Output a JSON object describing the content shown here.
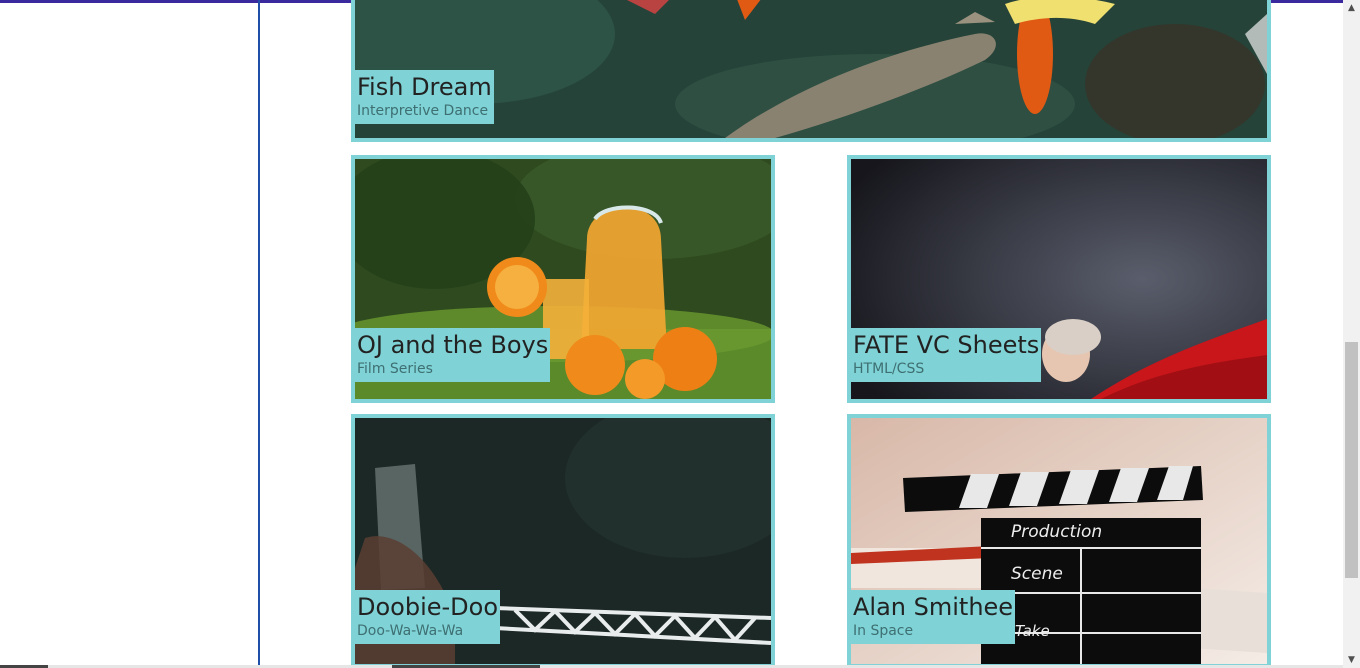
{
  "cards": [
    {
      "title": "Fish Dream",
      "subtitle": "Interpretive Dance"
    },
    {
      "title": "OJ and the Boys",
      "subtitle": "Film Series"
    },
    {
      "title": "FATE VC Sheets",
      "subtitle": "HTML/CSS"
    },
    {
      "title": "Doobie-Doo",
      "subtitle": "Doo-Wa-Wa-Wa"
    },
    {
      "title": "Alan Smithee",
      "subtitle": "In Space"
    }
  ],
  "clapperboard": {
    "production": "Production",
    "scene": "Scene",
    "take": "Take"
  },
  "scrollbar": {
    "up": "▲",
    "down": "▼"
  },
  "colors": {
    "accent": "#7fd3d6",
    "top_bar": "#3a2a9e",
    "sidebar_border": "#1f4fa6"
  }
}
